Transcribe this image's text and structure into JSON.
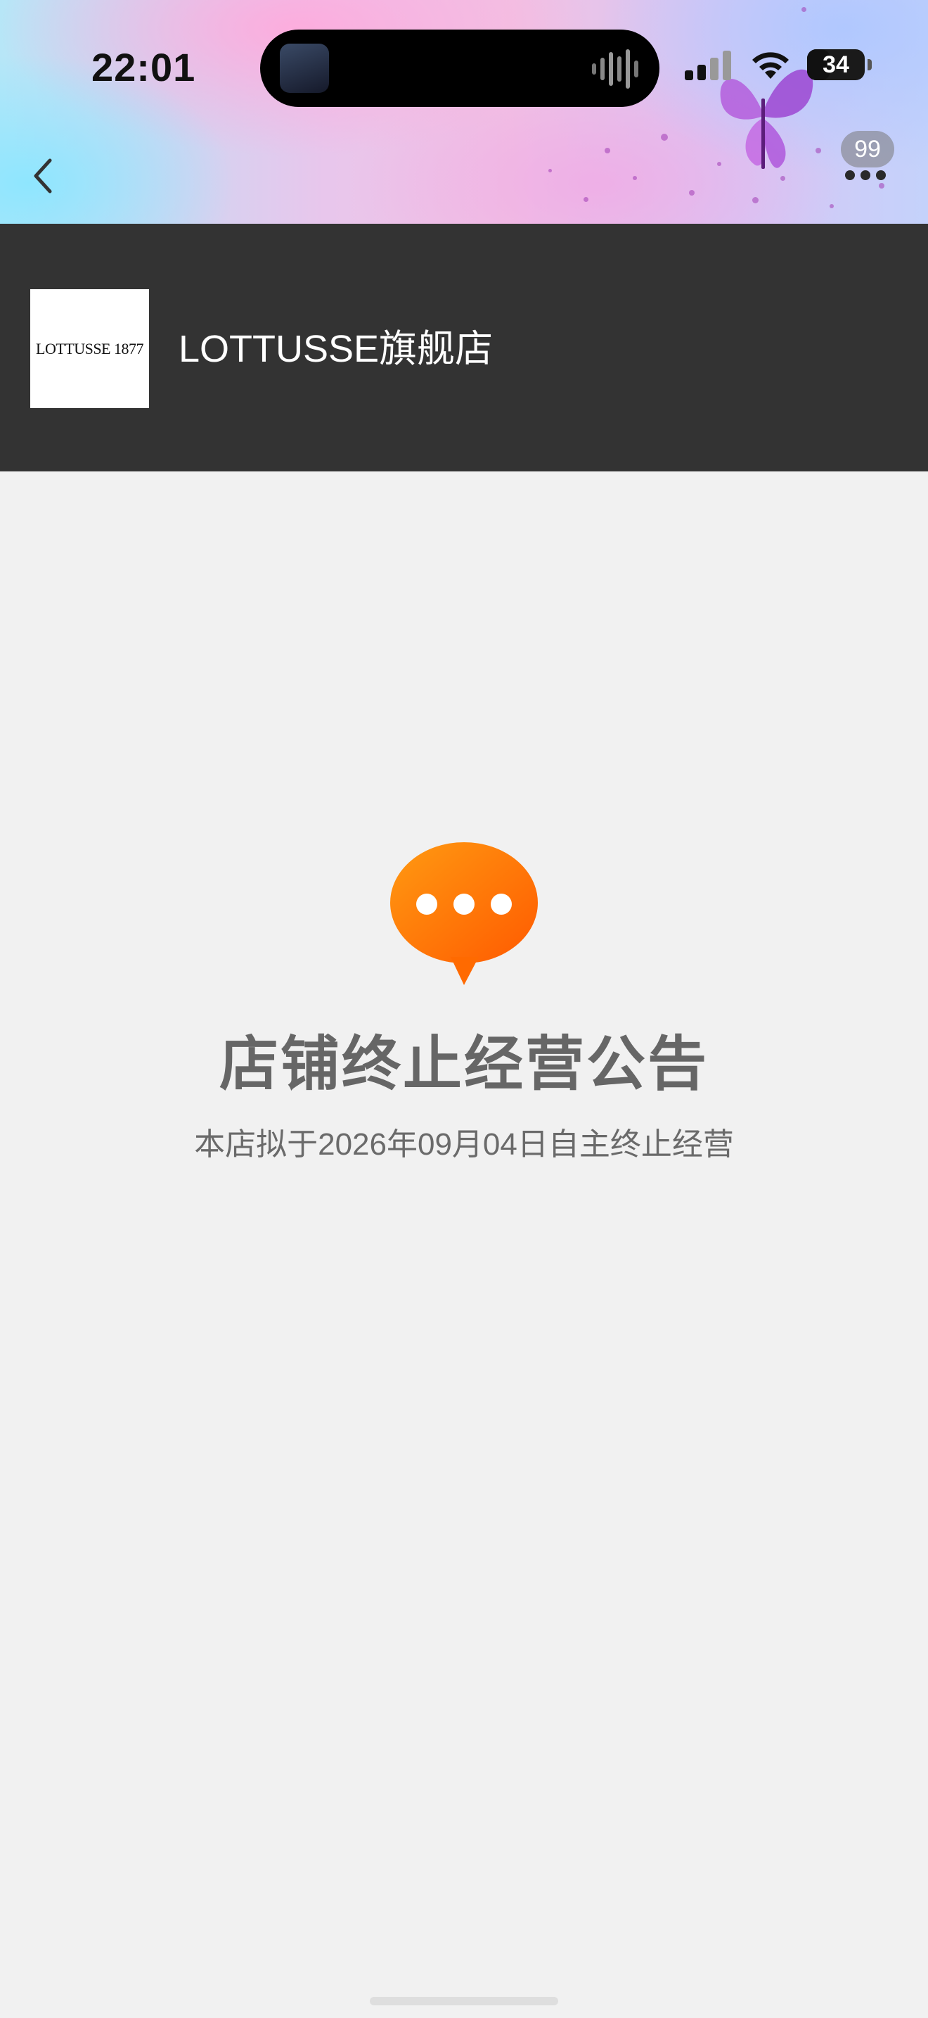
{
  "status_bar": {
    "time": "22:01",
    "battery": "34"
  },
  "nav": {
    "message_count": "99"
  },
  "store": {
    "logo_text": "LOTTUSSE 1877",
    "name": "LOTTUSSE旗舰店"
  },
  "notice": {
    "title": "店铺终止经营公告",
    "text": "本店拟于2026年09月04日自主终止经营"
  },
  "colors": {
    "store_bar": "#333333",
    "accent_orange": "#ff6a00",
    "background": "#f1f1f1"
  }
}
